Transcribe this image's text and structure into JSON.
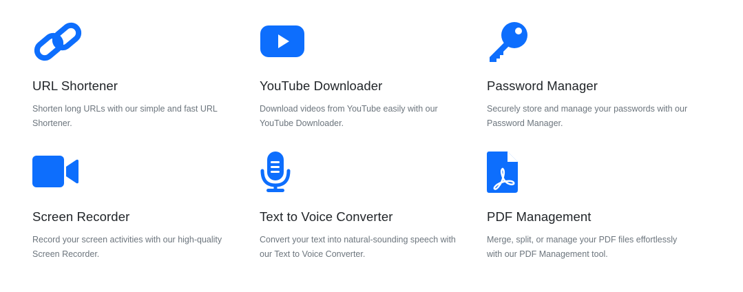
{
  "accent_color": "#0d6efd",
  "tools": [
    {
      "icon": "link-icon",
      "title": "URL Shortener",
      "description": "Shorten long URLs with our simple and fast URL Shortener."
    },
    {
      "icon": "youtube-play-icon",
      "title": "YouTube Downloader",
      "description": "Download videos from YouTube easily with our YouTube Downloader."
    },
    {
      "icon": "key-icon",
      "title": "Password Manager",
      "description": "Securely store and manage your passwords with our Password Manager."
    },
    {
      "icon": "video-camera-icon",
      "title": "Screen Recorder",
      "description": "Record your screen activities with our high-quality Screen Recorder."
    },
    {
      "icon": "microphone-icon",
      "title": "Text to Voice Converter",
      "description": "Convert your text into natural-sounding speech with our Text to Voice Converter."
    },
    {
      "icon": "pdf-file-icon",
      "title": "PDF Management",
      "description": "Merge, split, or manage your PDF files effortlessly with our PDF Management tool."
    }
  ]
}
